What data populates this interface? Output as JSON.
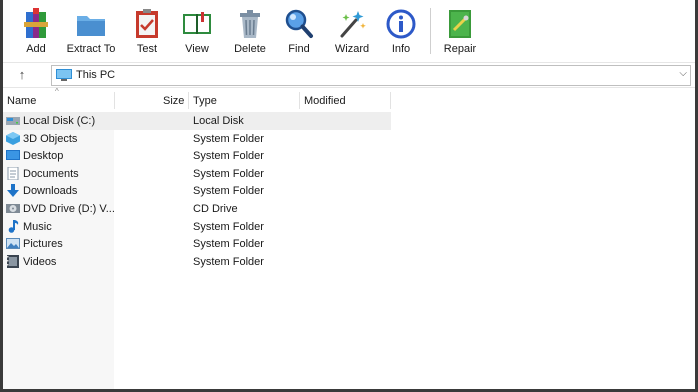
{
  "toolbar": {
    "buttons": [
      {
        "label": "Add",
        "icon": "add-archive-icon"
      },
      {
        "label": "Extract To",
        "icon": "extract-folder-icon"
      },
      {
        "label": "Test",
        "icon": "test-clipboard-icon"
      },
      {
        "label": "View",
        "icon": "view-book-icon"
      },
      {
        "label": "Delete",
        "icon": "trash-icon"
      },
      {
        "label": "Find",
        "icon": "magnifier-icon"
      },
      {
        "label": "Wizard",
        "icon": "wand-icon"
      },
      {
        "label": "Info",
        "icon": "info-icon"
      },
      {
        "label": "Repair",
        "icon": "repair-kit-icon"
      }
    ]
  },
  "address": {
    "up_glyph": "↑",
    "path": "This PC",
    "dropdown_glyph": "⌵"
  },
  "columns": {
    "name": "Name",
    "size": "Size",
    "type": "Type",
    "modified": "Modified"
  },
  "items": [
    {
      "name": "Local Disk (C:)",
      "type": "Local Disk",
      "icon": "local-disk-icon",
      "selected": true
    },
    {
      "name": "3D Objects",
      "type": "System Folder",
      "icon": "3d-objects-icon"
    },
    {
      "name": "Desktop",
      "type": "System Folder",
      "icon": "desktop-icon"
    },
    {
      "name": "Documents",
      "type": "System Folder",
      "icon": "documents-icon"
    },
    {
      "name": "Downloads",
      "type": "System Folder",
      "icon": "downloads-icon"
    },
    {
      "name": "DVD Drive (D:) V...",
      "type": "CD Drive",
      "icon": "dvd-drive-icon"
    },
    {
      "name": "Music",
      "type": "System Folder",
      "icon": "music-icon"
    },
    {
      "name": "Pictures",
      "type": "System Folder",
      "icon": "pictures-icon"
    },
    {
      "name": "Videos",
      "type": "System Folder",
      "icon": "videos-icon"
    }
  ]
}
